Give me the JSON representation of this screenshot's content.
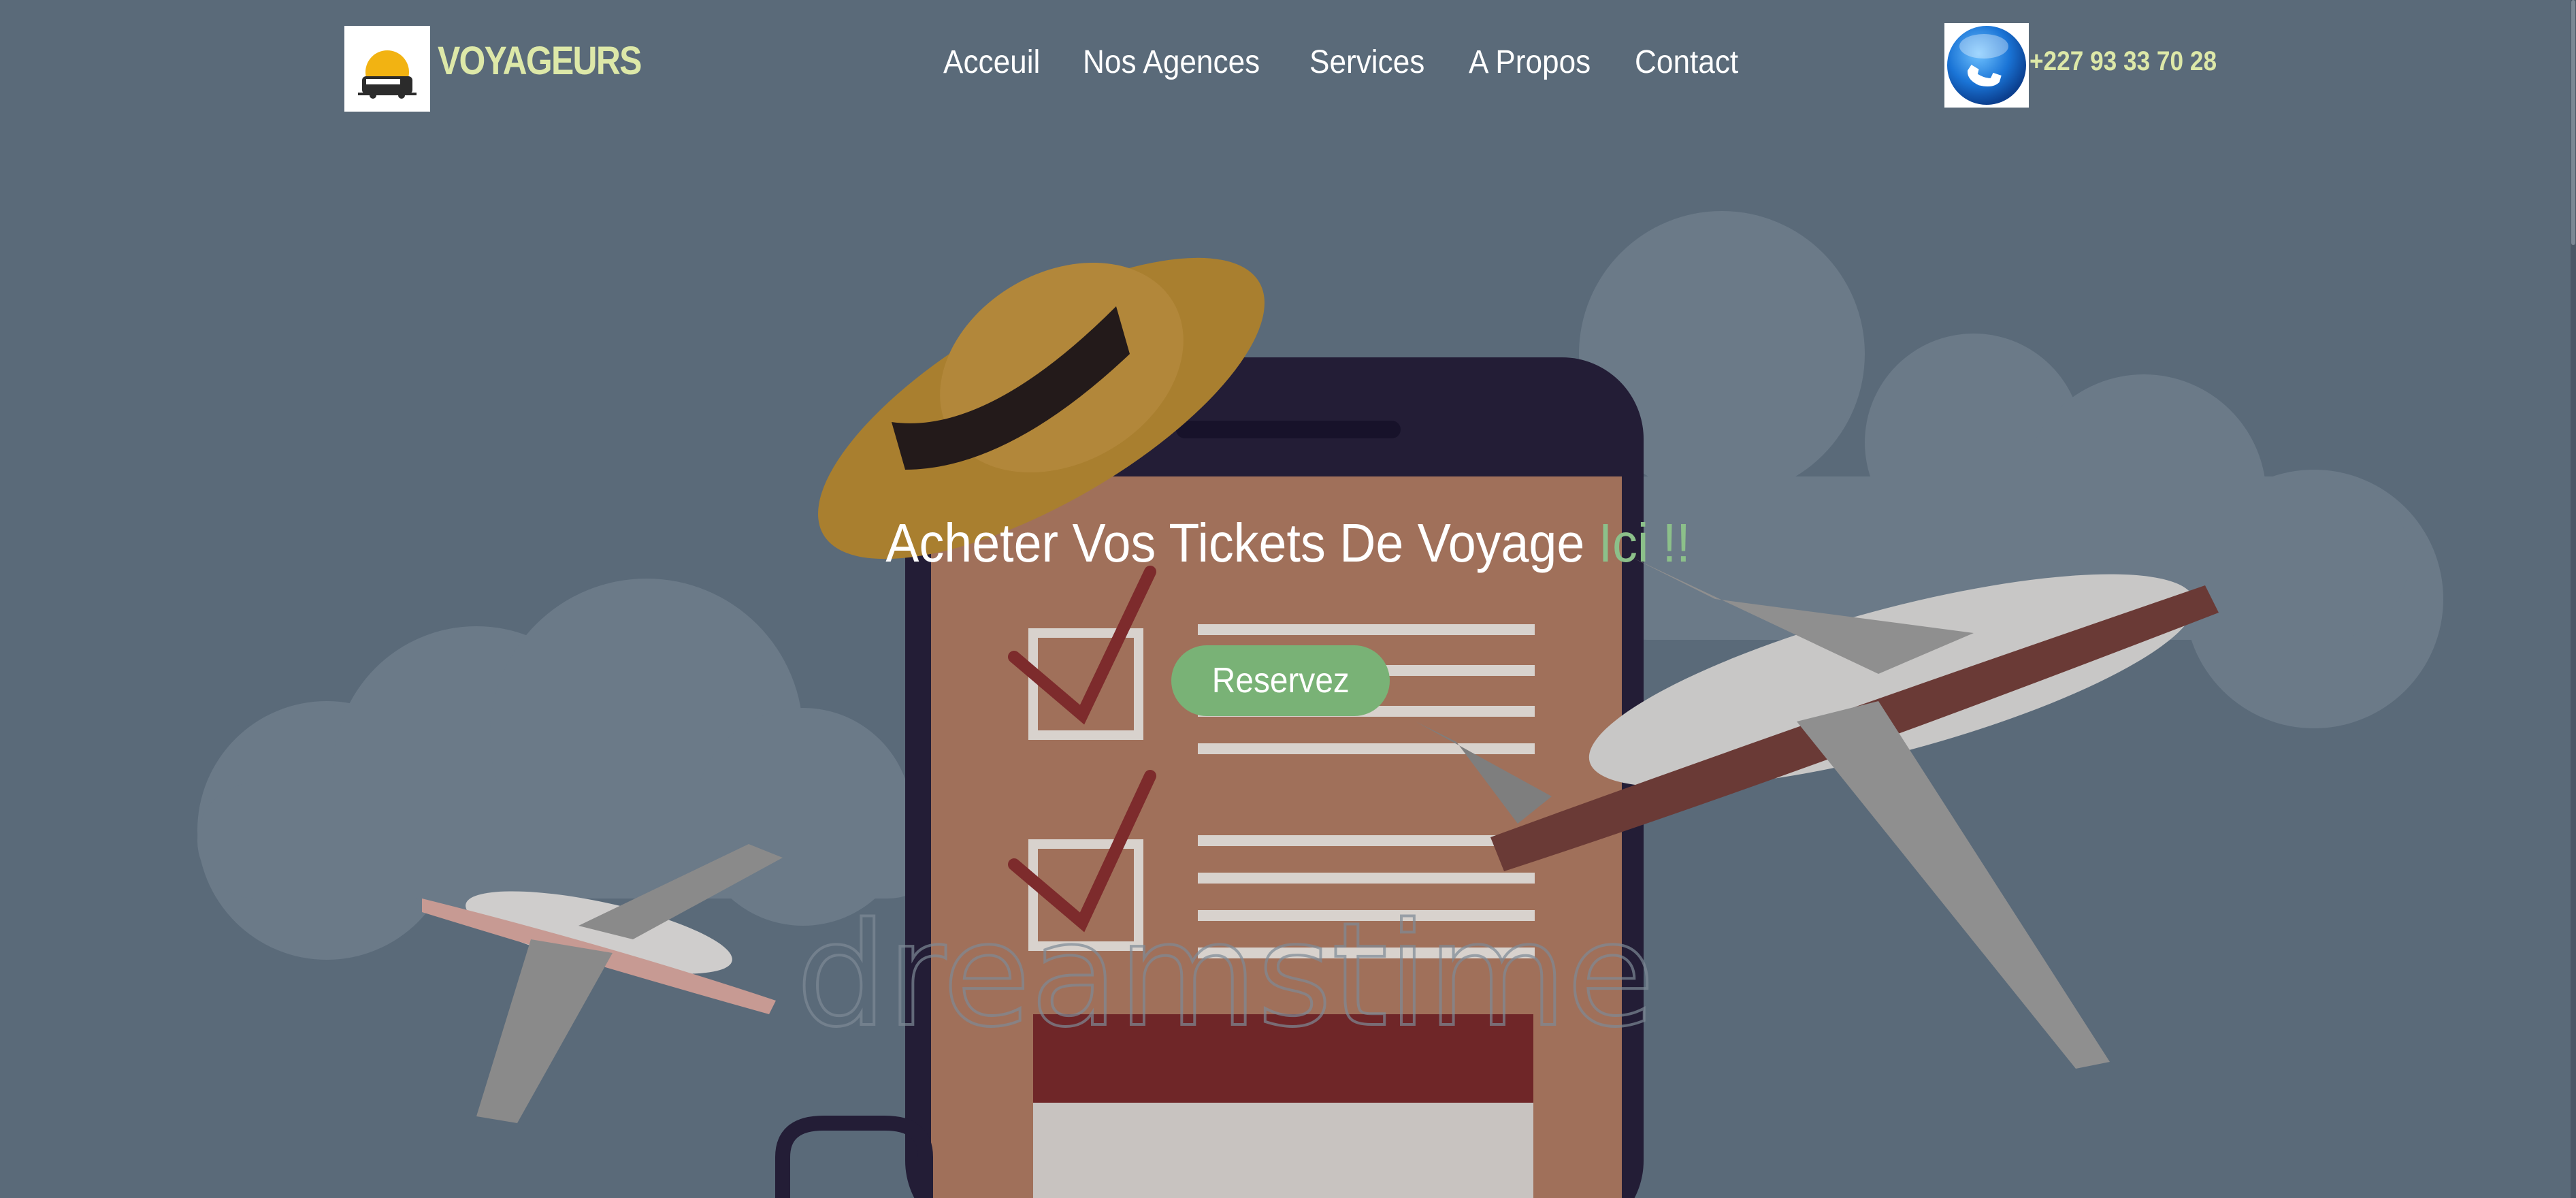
{
  "brand": {
    "name": "VOYAGEURS",
    "logo_icon": "bus-sunset-logo-icon"
  },
  "nav": {
    "items": [
      {
        "label": "Acceuil"
      },
      {
        "label": "Nos Agences"
      },
      {
        "label": "Services"
      },
      {
        "label": "A Propos"
      },
      {
        "label": "Contact"
      }
    ]
  },
  "contact": {
    "phone_icon": "phone-icon",
    "phone": "+227 93 33 70 28"
  },
  "hero": {
    "title_main": "Acheter Vos Tickets De Voyage ",
    "title_accent": "Ici !!",
    "cta_label": "Reservez",
    "watermark": "dreamstime"
  },
  "colors": {
    "overlay": "#5b6b7a",
    "brand": "#dde8a8",
    "accent": "#8cc08a",
    "button": "#79b276",
    "text": "#ffffff"
  }
}
